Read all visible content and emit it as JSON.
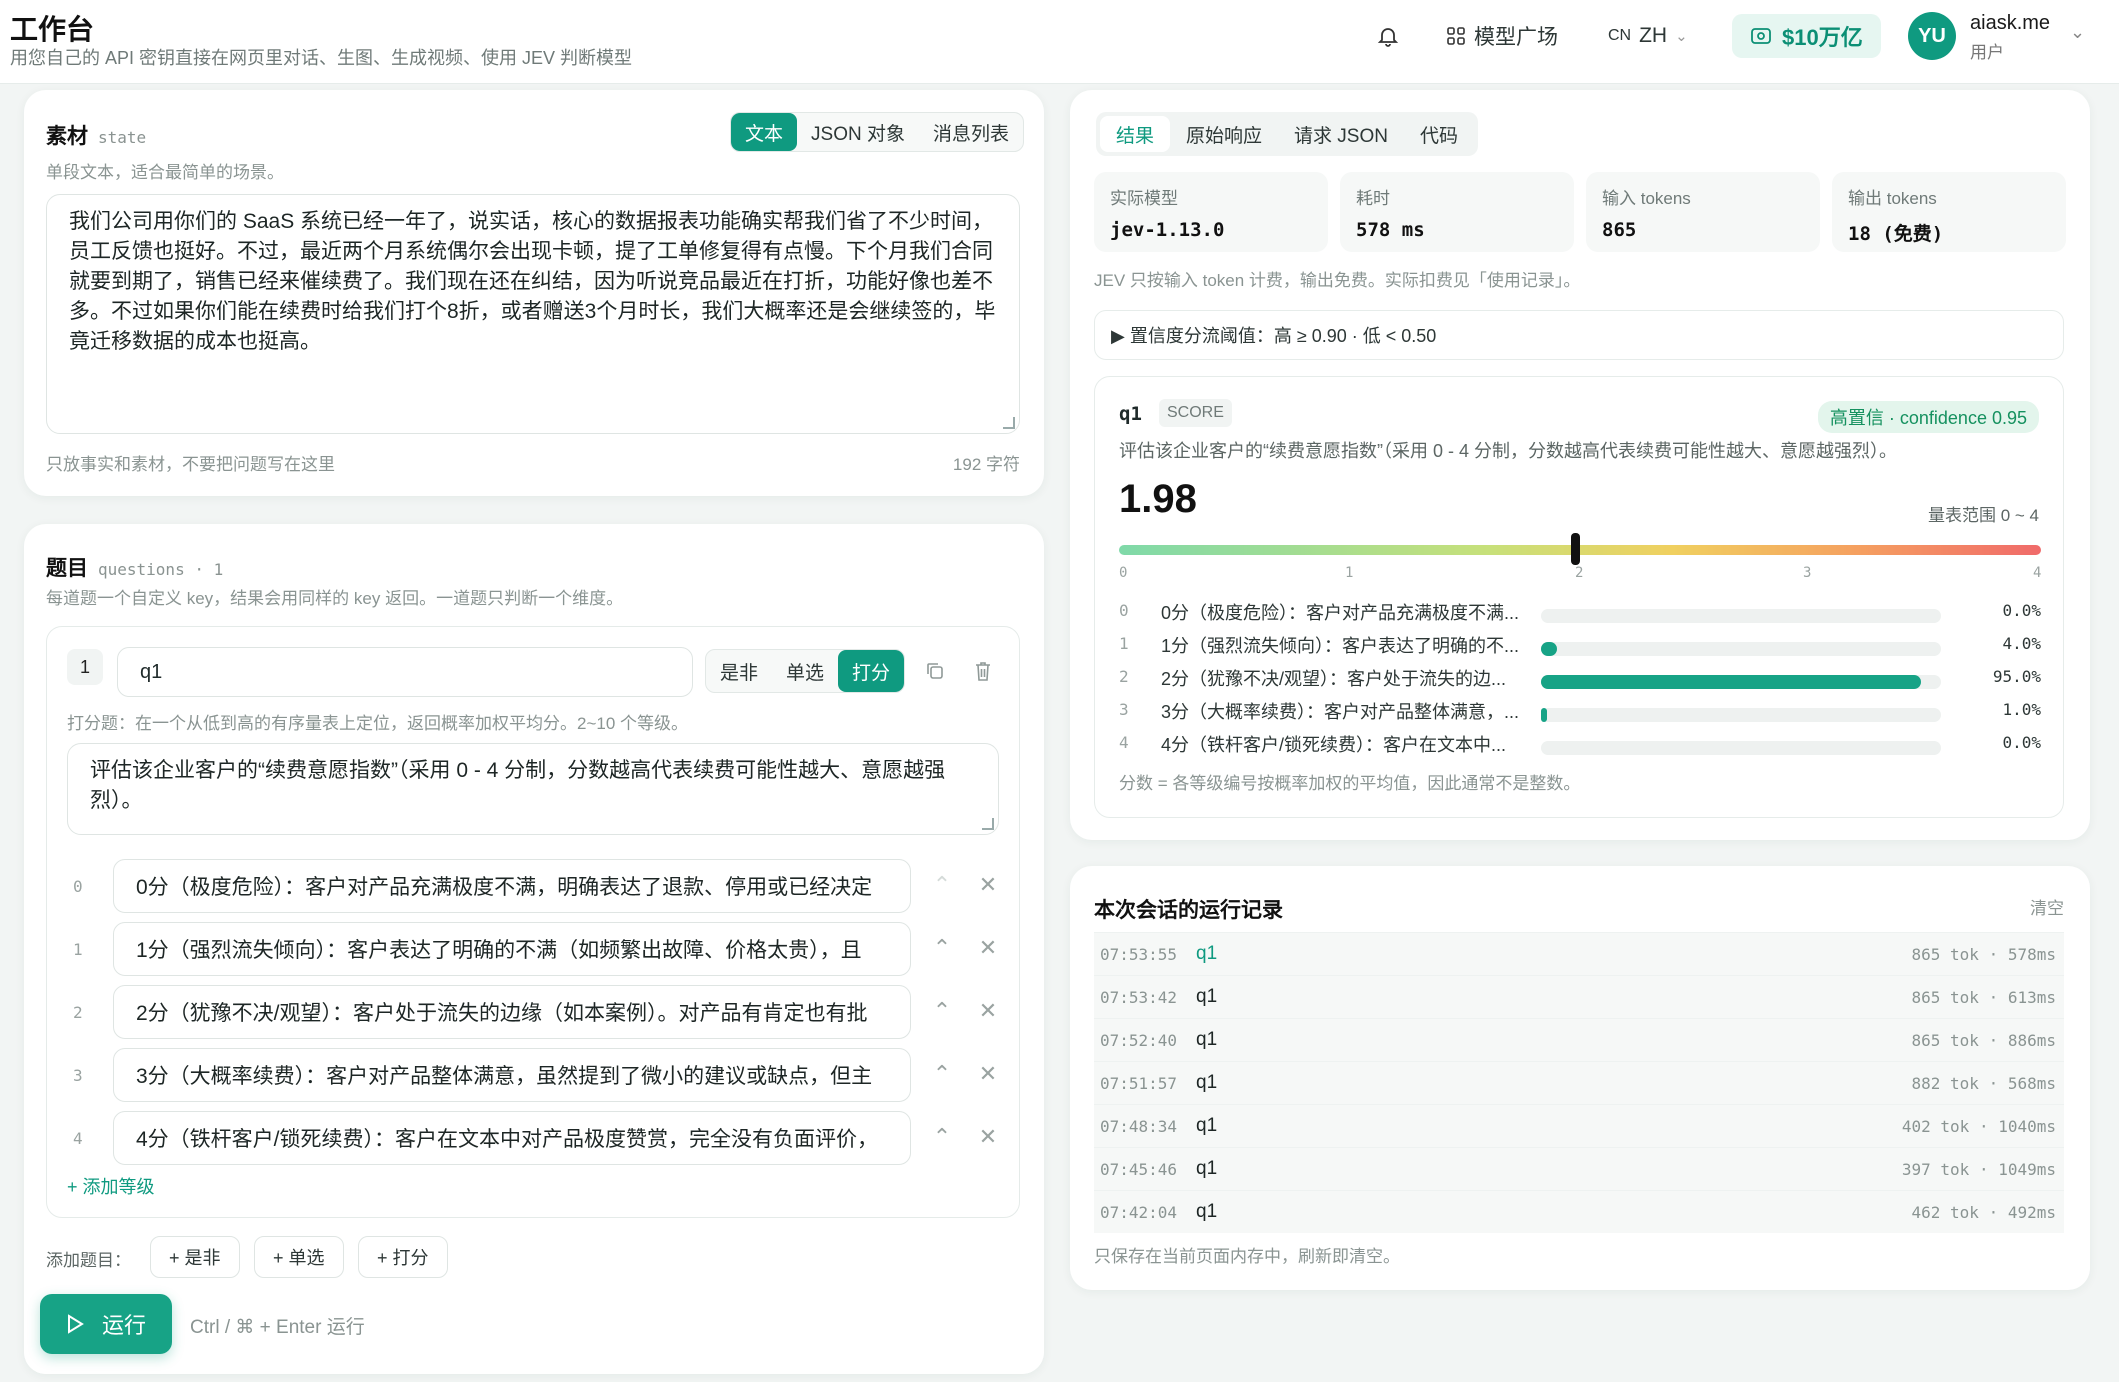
{
  "header": {
    "title": "工作台",
    "subtitle": "用您自己的 API 密钥直接在网页里对话、生图、生成视频、使用 JEV 判断模型",
    "models_label": "模型广场",
    "lang_code": "CN",
    "lang": "ZH",
    "credit": "$10万亿",
    "avatar": "YU",
    "user_name": "aiask.me",
    "user_role": "用户"
  },
  "material": {
    "title": "素材",
    "tag": "state",
    "desc": "单段文本，适合最简单的场景。",
    "modes": [
      "文本",
      "JSON 对象",
      "消息列表"
    ],
    "active_mode": "文本",
    "text": "我们公司用你们的 SaaS 系统已经一年了，说实话，核心的数据报表功能确实帮我们省了不少时间，员工反馈也挺好。不过，最近两个月系统偶尔会出现卡顿，提了工单修复得有点慢。下个月我们合同就要到期了，销售已经来催续费了。我们现在还在纠结，因为听说竞品最近在打折，功能好像也差不多。不过如果你们能在续费时给我们打个8折，或者赠送3个月时长，我们大概率还是会继续签的，毕竟迁移数据的成本也挺高。",
    "footer_hint": "只放事实和素材，不要把问题写在这里",
    "char_count": "192 字符"
  },
  "questions": {
    "title": "题目",
    "tag": "questions · 1",
    "desc": "每道题一个自定义 key，结果会用同样的 key 返回。一道题只判断一个维度。",
    "q_index": "1",
    "q_key": "q1",
    "types": [
      "是非",
      "单选",
      "打分"
    ],
    "active_type": "打分",
    "type_desc": "打分题：在一个从低到高的有序量表上定位，返回概率加权平均分。2~10 个等级。",
    "prompt": "评估该企业客户的“续费意愿指数”（采用 0 - 4 分制，分数越高代表续费可能性越大、意愿越强烈）。",
    "levels": [
      {
        "idx": "0",
        "text": "0分（极度危险）：客户对产品充满极度不满，明确表达了退款、停用或已经决定"
      },
      {
        "idx": "1",
        "text": "1分（强烈流失倾向）：客户表达了明确的不满（如频繁出故障、价格太贵），且"
      },
      {
        "idx": "2",
        "text": "2分（犹豫不决/观望）：客户处于流失的边缘（如本案例）。对产品有肯定也有批"
      },
      {
        "idx": "3",
        "text": "3分（大概率续费）：客户对产品整体满意，虽然提到了微小的建议或缺点，但主"
      },
      {
        "idx": "4",
        "text": "4分（铁杆客户/锁死续费）：客户在文本中对产品极度赞赏，完全没有负面评价，"
      }
    ],
    "add_level": "+ 添加等级",
    "add_label": "添加题目：",
    "add_buttons": [
      "+ 是非",
      "+ 单选",
      "+ 打分"
    ],
    "run_label": "运行",
    "run_hint": "Ctrl / ⌘ + Enter 运行"
  },
  "result_tabs": [
    "结果",
    "原始响应",
    "请求 JSON",
    "代码"
  ],
  "active_result_tab": "结果",
  "stats": [
    {
      "k": "实际模型",
      "v": "jev-1.13.0"
    },
    {
      "k": "耗时",
      "v": "578 ms"
    },
    {
      "k": "输入 tokens",
      "v": "865"
    },
    {
      "k": "输出 tokens",
      "v": "18 (免费)"
    }
  ],
  "billing_note": "JEV 只按输入 token 计费，输出免费。实际扣费见「使用记录」。",
  "threshold": "▶ 置信度分流阈值：高 ≥ 0.90 · 低 < 0.50",
  "result": {
    "key": "q1",
    "type": "SCORE",
    "confidence": "高置信 · confidence 0.95",
    "prompt": "评估该企业客户的“续费意愿指数”（采用 0 - 4 分制，分数越高代表续费可能性越大、意愿越强烈）。",
    "score": "1.98",
    "score_value": 1.98,
    "scale_min": 0,
    "scale_max": 4,
    "range_label": "量表范围 0 ~ 4",
    "ticks": [
      "0",
      "1",
      "2",
      "3",
      "4"
    ],
    "distribution": [
      {
        "idx": "0",
        "label": "0分（极度危险）：客户对产品充满极度不满...",
        "pct": "0.0%",
        "value": 0.0
      },
      {
        "idx": "1",
        "label": "1分（强烈流失倾向）：客户表达了明确的不...",
        "pct": "4.0%",
        "value": 4.0
      },
      {
        "idx": "2",
        "label": "2分（犹豫不决/观望）：客户处于流失的边...",
        "pct": "95.0%",
        "value": 95.0
      },
      {
        "idx": "3",
        "label": "3分（大概率续费）：客户对产品整体满意，...",
        "pct": "1.0%",
        "value": 1.0
      },
      {
        "idx": "4",
        "label": "4分（铁杆客户/锁死续费）：客户在文本中...",
        "pct": "0.0%",
        "value": 0.0
      }
    ],
    "footnote": "分数 = 各等级编号按概率加权的平均值，因此通常不是整数。"
  },
  "log": {
    "title": "本次会话的运行记录",
    "clear": "清空",
    "rows": [
      {
        "time": "07:53:55",
        "q": "q1",
        "meta": "865 tok · 578ms"
      },
      {
        "time": "07:53:42",
        "q": "q1",
        "meta": "865 tok · 613ms"
      },
      {
        "time": "07:52:40",
        "q": "q1",
        "meta": "865 tok · 886ms"
      },
      {
        "time": "07:51:57",
        "q": "q1",
        "meta": "882 tok · 568ms"
      },
      {
        "time": "07:48:34",
        "q": "q1",
        "meta": "402 tok · 1040ms"
      },
      {
        "time": "07:45:46",
        "q": "q1",
        "meta": "397 tok · 1049ms"
      },
      {
        "time": "07:42:04",
        "q": "q1",
        "meta": "462 tok · 492ms"
      }
    ],
    "footnote": "只保存在当前页面内存中，刷新即清空。"
  },
  "colors": {
    "accent": "#0f9a80",
    "accent_light": "#e6f6f1"
  }
}
